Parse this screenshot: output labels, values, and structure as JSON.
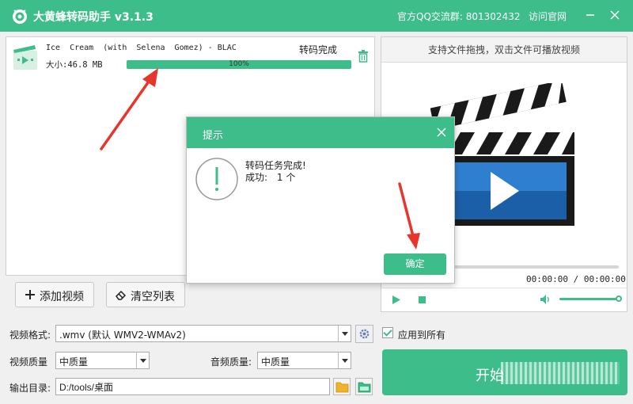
{
  "titlebar": {
    "app_title": "大黄蜂转码助手 v3.1.3",
    "qq_group": "官方QQ交流群: 801302432",
    "visit_site": "访问官网"
  },
  "file_list": {
    "items": [
      {
        "name": "Ice  Cream  (with  Selena  Gomez) - BLAC",
        "size": "大小:46.8 MB",
        "status": "转码完成",
        "progress_percent": 100,
        "progress_label": "100%"
      }
    ],
    "add_video_label": "添加视频",
    "clear_list_label": "清空列表"
  },
  "preview": {
    "header_hint": "支持文件拖拽，双击文件可播放视频",
    "timecode": "00:00:00 / 00:00:00",
    "volume_level": 1.0
  },
  "settings": {
    "video_format_label": "视频格式:",
    "video_format_value": ".wmv (默认 WMV2-WMAv2)",
    "apply_all_label": "应用到所有",
    "video_quality_label": "视频质量",
    "video_quality_value": "中质量",
    "audio_quality_label": "音频质量:",
    "audio_quality_value": "中质量",
    "output_dir_label": "输出目录:",
    "output_dir_value": "D:/tools/桌面",
    "start_label": "开始"
  },
  "dialog": {
    "title": "提示",
    "message_line1": "转码任务完成!",
    "message_line2_label": "成功:",
    "message_line2_count": "1 个",
    "ok_label": "确定"
  },
  "colors": {
    "accent": "#3dbd8a",
    "annotation_arrow": "#e8352b"
  }
}
